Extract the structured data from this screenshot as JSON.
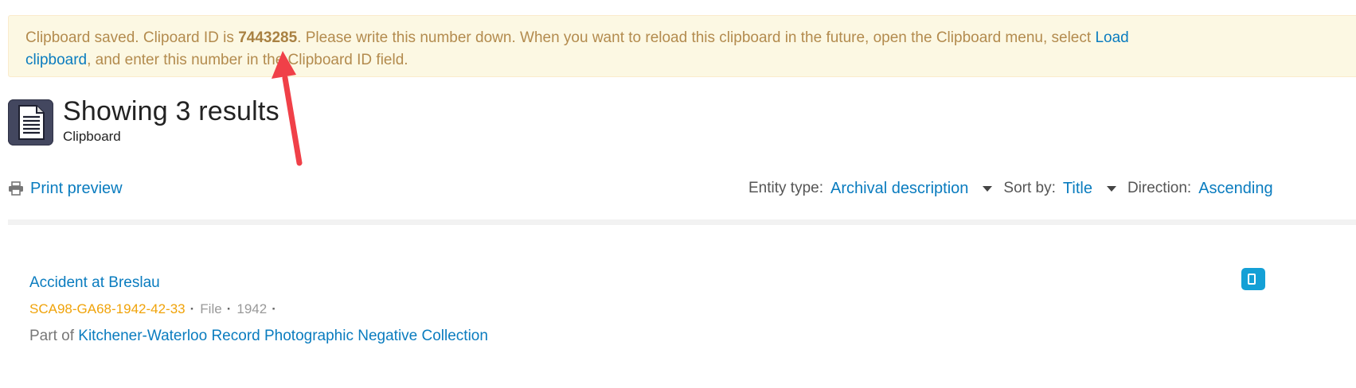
{
  "alert": {
    "prefix": "Clipboard saved. Clipoard ID is ",
    "clipboard_id": "7443285",
    "middle": ". Please write this number down. When you want to reload this clipboard in the future, open the Clipboard menu, select ",
    "link_load": "Load",
    "link_clipboard": "clipboard",
    "suffix": ", and enter this number in the Clipboard ID field."
  },
  "header": {
    "title": "Showing 3 results",
    "subtitle": "Clipboard",
    "icon": "document-icon"
  },
  "toolbar": {
    "print_label": "Print preview",
    "print_icon": "printer-icon",
    "entity_label": "Entity type:",
    "entity_value": "Archival description",
    "sort_label": "Sort by:",
    "sort_value": "Title",
    "direction_label": "Direction:",
    "direction_value": "Ascending"
  },
  "results": [
    {
      "title": "Accident at Breslau",
      "reference": "SCA98-GA68-1942-42-33",
      "level": "File",
      "date": "1942",
      "part_of_label": "Part of",
      "part_of": "Kitchener-Waterloo Record Photographic Negative Collection"
    }
  ],
  "colors": {
    "link": "#0a7cbf",
    "alert_bg": "#fcf8e3",
    "alert_text": "#b38b4e",
    "reference": "#f0a30a",
    "annotation_arrow": "#f04048"
  }
}
